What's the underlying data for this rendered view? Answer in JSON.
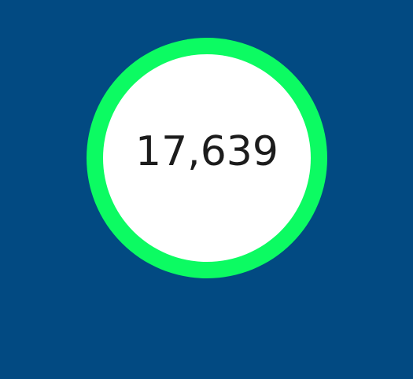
{
  "counter": {
    "value": "17,639"
  },
  "colors": {
    "background": "#024a82",
    "ring": "#0cfb62",
    "disc": "#ffffff",
    "text": "#1c1c1c"
  }
}
